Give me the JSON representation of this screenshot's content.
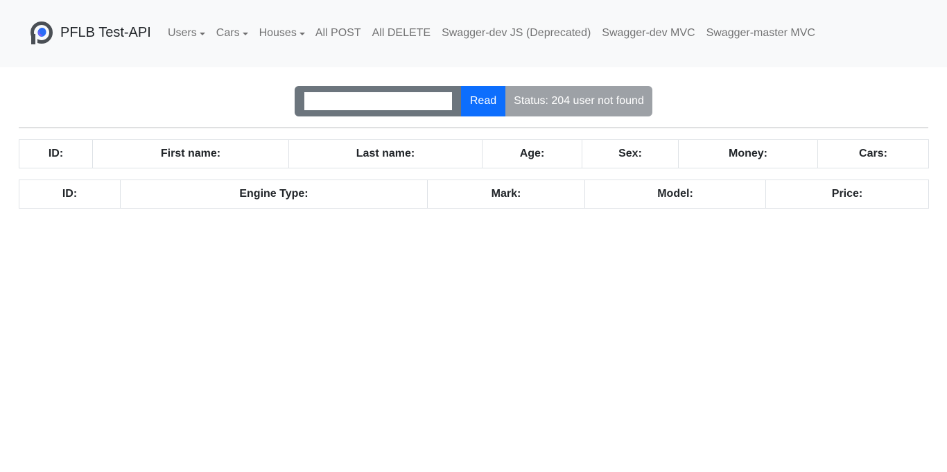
{
  "navbar": {
    "brand": "PFLB Test-API",
    "items": [
      {
        "label": "Users",
        "dropdown": true
      },
      {
        "label": "Cars",
        "dropdown": true
      },
      {
        "label": "Houses",
        "dropdown": true
      },
      {
        "label": "All POST",
        "dropdown": false
      },
      {
        "label": "All DELETE",
        "dropdown": false
      },
      {
        "label": "Swagger-dev JS (Deprecated)",
        "dropdown": false
      },
      {
        "label": "Swagger-dev MVC",
        "dropdown": false
      },
      {
        "label": "Swagger-master MVC",
        "dropdown": false
      }
    ]
  },
  "form": {
    "input_value": "",
    "input_placeholder": "",
    "read_label": "Read",
    "status_text": "Status: 204 user not found"
  },
  "users_table": {
    "headers": [
      "ID:",
      "First name:",
      "Last name:",
      "Age:",
      "Sex:",
      "Money:",
      "Cars:"
    ]
  },
  "cars_table": {
    "headers": [
      "ID:",
      "Engine Type:",
      "Mark:",
      "Model:",
      "Price:"
    ]
  },
  "colors": {
    "navbar_bg": "#f8f9fa",
    "primary": "#0d6efd",
    "secondary": "#6c757d",
    "status_bg": "#9da1a6"
  }
}
